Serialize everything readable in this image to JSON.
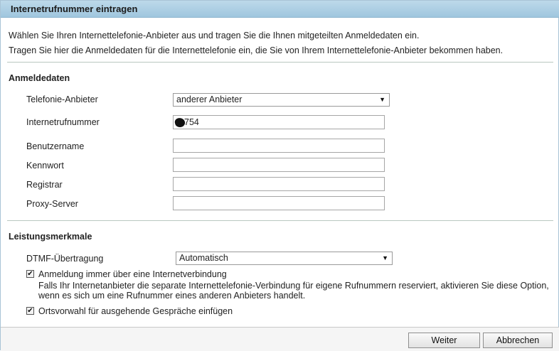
{
  "title": "Internetrufnummer eintragen",
  "intro": {
    "line1": "Wählen Sie Ihren Internettelefonie-Anbieter aus und tragen Sie die Ihnen mitgeteilten Anmeldedaten ein.",
    "line2": "Tragen Sie hier die Anmeldedaten für die Internettelefonie ein, die Sie von Ihrem Internettelefonie-Anbieter bekommen haben."
  },
  "anmeldedaten": {
    "heading": "Anmeldedaten",
    "provider_label": "Telefonie-Anbieter",
    "provider_value": "anderer Anbieter",
    "number_label": "Internetrufnummer",
    "number_value": "754",
    "username_label": "Benutzername",
    "username_value": "",
    "password_label": "Kennwort",
    "password_value": "",
    "registrar_label": "Registrar",
    "registrar_value": "",
    "proxy_label": "Proxy-Server",
    "proxy_value": ""
  },
  "leistungsmerkmale": {
    "heading": "Leistungsmerkmale",
    "dtmf_label": "DTMF-Übertragung",
    "dtmf_value": "Automatisch",
    "opt1_label": "Anmeldung immer über eine Internetverbindung",
    "opt1_checked": true,
    "opt1_note": "Falls Ihr Internetanbieter die separate Internettelefonie-Verbindung für eigene Rufnummern reserviert, aktivieren Sie diese Option, wenn es sich um eine Rufnummer eines anderen Anbieters handelt.",
    "opt2_label": "Ortsvorwahl für ausgehende Gespräche einfügen",
    "opt2_checked": true
  },
  "buttons": {
    "next": "Weiter",
    "cancel": "Abbrechen"
  },
  "icons": {
    "dropdown": "dropdown-arrow-icon",
    "checkbox": "checkmark-icon"
  }
}
